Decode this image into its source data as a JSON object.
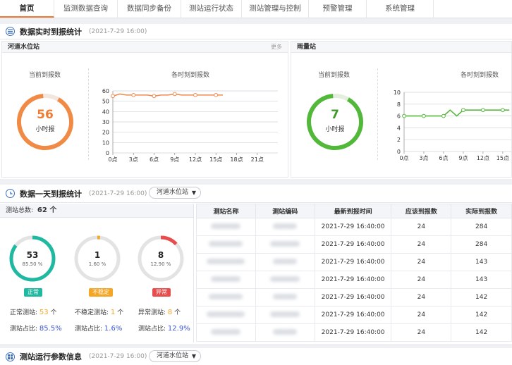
{
  "nav": [
    {
      "label": "首页",
      "w": 77
    },
    {
      "label": "监测数据查询",
      "w": 90
    },
    {
      "label": "数据同步备份",
      "w": 90
    },
    {
      "label": "测站运行状态",
      "w": 86
    },
    {
      "label": "测站管理与控制",
      "w": 95
    },
    {
      "label": "预警管理",
      "w": 82
    },
    {
      "label": "系统管理",
      "w": 95
    }
  ],
  "realtime": {
    "title": "数据实时到报统计",
    "time": "(2021-7-29 16:00)",
    "panels": [
      {
        "name": "河道水位站",
        "more": "更多",
        "current_label": "当前到报数",
        "current_value": "56",
        "unit": "小时报",
        "hourly_label": "各时刻到报数",
        "gauge_color": "#f08a45"
      },
      {
        "name": "雨量站",
        "current_label": "当前到报数",
        "current_value": "7",
        "unit": "小时报",
        "hourly_label": "各时刻到报数",
        "gauge_color": "#52b83a"
      }
    ]
  },
  "chart_data": [
    {
      "type": "line",
      "x_ticks": [
        "0点",
        "3点",
        "6点",
        "9点",
        "12点",
        "15点",
        "18点",
        "21点"
      ],
      "y_ticks": [
        "0",
        "10",
        "20",
        "30",
        "40",
        "50",
        "60"
      ],
      "ylim": [
        0,
        60
      ],
      "x": [
        0,
        1,
        2,
        3,
        4,
        5,
        6,
        7,
        8,
        9,
        10,
        11,
        12,
        13,
        14,
        15,
        16
      ],
      "values": [
        55,
        57,
        56,
        56,
        56,
        56,
        55,
        56,
        56,
        57,
        56,
        56,
        56,
        56,
        56,
        56,
        56
      ],
      "markers": [
        0,
        3,
        6,
        9,
        12,
        15
      ],
      "color": "#ef8a4f"
    },
    {
      "type": "line",
      "x_ticks": [
        "0点",
        "3点",
        "6点",
        "9点",
        "12点",
        "15点"
      ],
      "y_ticks": [
        "0",
        "2",
        "4",
        "6",
        "8",
        "10"
      ],
      "ylim": [
        0,
        10
      ],
      "x": [
        0,
        1,
        2,
        3,
        4,
        5,
        6,
        7,
        8,
        9,
        10,
        11,
        12,
        13,
        14,
        15,
        16
      ],
      "values": [
        6,
        6,
        6,
        6,
        6,
        6,
        6,
        7,
        6,
        7,
        7,
        7,
        7,
        7,
        7,
        7,
        7
      ],
      "markers": [
        0,
        3,
        6,
        9,
        12,
        15
      ],
      "color": "#55b83b"
    }
  ],
  "daily": {
    "title": "数据一天到报统计",
    "time": "(2021-7-29 16:00)",
    "select": "河道水位站",
    "total_label": "测站总数:",
    "total_value": "62 个",
    "rings": [
      {
        "value": "53",
        "pct": "85.50 %",
        "fraction": 0.855,
        "color": "#1fb8a0",
        "badge": "正常",
        "badge_color": "#1fb8a0"
      },
      {
        "value": "1",
        "pct": "1.60 %",
        "fraction": 0.016,
        "color": "#f5a623",
        "badge": "不稳定",
        "badge_color": "#f5a623"
      },
      {
        "value": "8",
        "pct": "12.90 %",
        "fraction": 0.129,
        "color": "#e84d4d",
        "badge": "异常",
        "badge_color": "#e84d4d"
      }
    ],
    "stats": [
      {
        "label": "正常测站:",
        "value": "53",
        "unit": "个",
        "color": "#f5a623"
      },
      {
        "label": "不稳定测站:",
        "value": "1",
        "unit": "个",
        "color": "#f5a623"
      },
      {
        "label": "异常测站:",
        "value": "8",
        "unit": "个",
        "color": "#f5a623"
      }
    ],
    "ratios": [
      {
        "label": "测站占比:",
        "value": "85.5%"
      },
      {
        "label": "测站占比:",
        "value": "1.6%"
      },
      {
        "label": "测站占比:",
        "value": "12.9%"
      }
    ],
    "table": {
      "headers": [
        "测站名称",
        "测站编码",
        "最新到报时间",
        "应该到报数",
        "实际到报数"
      ],
      "rows": [
        [
          "2021-7-29 16:40:00",
          "24",
          "284"
        ],
        [
          "2021-7-29 16:40:00",
          "24",
          "284"
        ],
        [
          "2021-7-29 16:40:00",
          "24",
          "143"
        ],
        [
          "2021-7-29 16:40:00",
          "24",
          "143"
        ],
        [
          "2021-7-29 16:40:00",
          "24",
          "142"
        ],
        [
          "2021-7-29 16:40:00",
          "24",
          "142"
        ],
        [
          "2021-7-29 16:40:00",
          "24",
          "142"
        ]
      ]
    }
  },
  "params": {
    "title": "测站运行参数信息",
    "time": "(2021-7-29 16:00)",
    "select": "河道水位站"
  }
}
